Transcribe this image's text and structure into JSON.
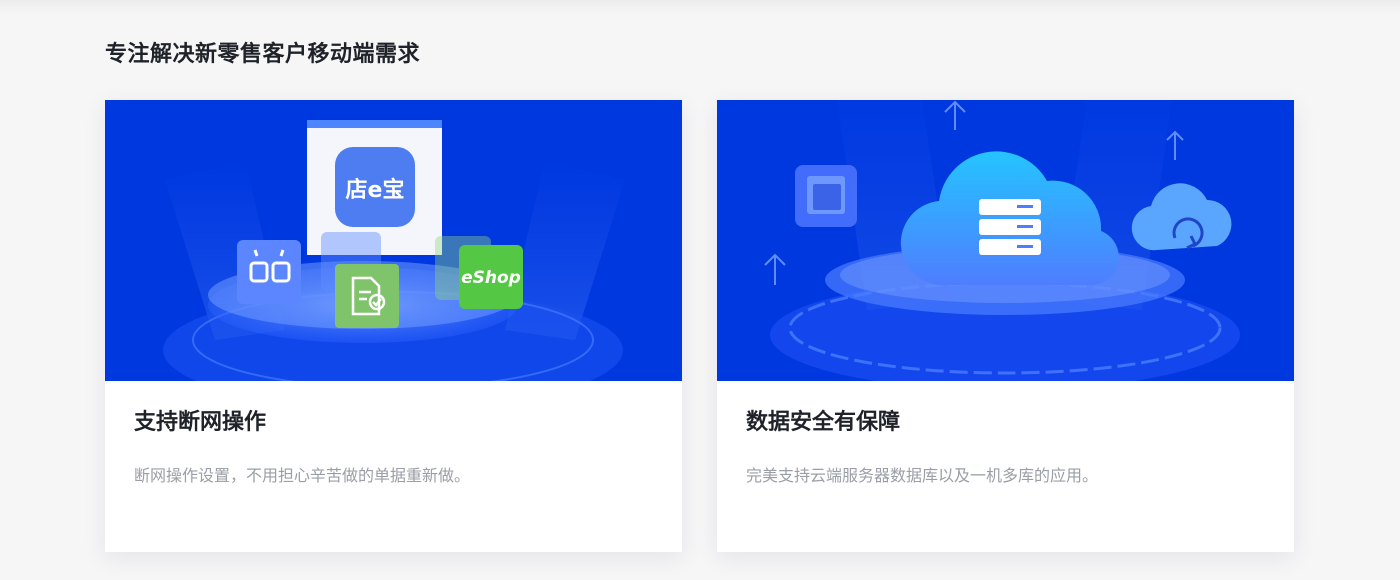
{
  "section": {
    "title": "专注解决新零售客户移动端需求"
  },
  "cards": [
    {
      "title": "支持断网操作",
      "description": "断网操作设置，不用担心辛苦做的单据重新做。",
      "illustration": {
        "app_logo_text": "店e宝",
        "shop_badge_text": "eShop",
        "icons": [
          "broken-link-icon",
          "document-check-icon",
          "store-app-icon",
          "eshop-icon"
        ]
      }
    },
    {
      "title": "数据安全有保障",
      "description": "完美支持云端服务器数据库以及一机多库的应用。",
      "illustration": {
        "icons": [
          "cloud-server-icon",
          "database-icon",
          "cloud-sync-icon",
          "window-icon",
          "arrow-up-icon"
        ]
      }
    }
  ],
  "colors": {
    "background": "#f6f6f7",
    "hero_blue": "#0038e0",
    "title": "#1f2329",
    "description": "#9a9ea6",
    "accent_green": "#5bc94f",
    "accent_blue": "#4d7df0"
  }
}
